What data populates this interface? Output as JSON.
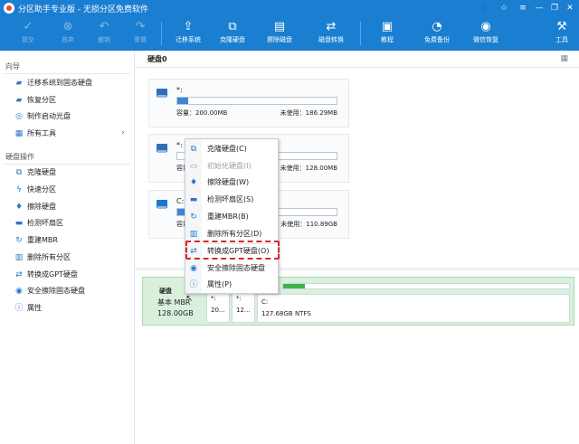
{
  "window": {
    "title": "分区助手专业版 - 无损分区免费软件"
  },
  "toolbar": {
    "buttons": [
      {
        "label": "提交",
        "icon": "commit-icon",
        "enabled": false
      },
      {
        "label": "放弃",
        "icon": "discard-icon",
        "enabled": false
      },
      {
        "label": "撤销",
        "icon": "undo-icon",
        "enabled": false
      },
      {
        "label": "重做",
        "icon": "redo-icon",
        "enabled": false
      },
      {
        "label": "迁移系统",
        "icon": "migrate-os-icon",
        "enabled": true
      },
      {
        "label": "克隆硬盘",
        "icon": "clone-disk-icon",
        "enabled": true
      },
      {
        "label": "擦除磁盘",
        "icon": "wipe-disk-icon",
        "enabled": true
      },
      {
        "label": "磁盘转换",
        "icon": "convert-disk-icon",
        "enabled": true
      },
      {
        "label": "教程",
        "icon": "tutorial-icon",
        "enabled": true
      },
      {
        "label": "免费备份",
        "icon": "backup-icon",
        "enabled": true
      },
      {
        "label": "微信恢复",
        "icon": "wechat-recovery-icon",
        "enabled": true
      },
      {
        "label": "工具",
        "icon": "tools-icon",
        "enabled": true
      }
    ]
  },
  "sidebar": {
    "wizard_title": "向导",
    "wizard_items": [
      {
        "label": "迁移系统到固态硬盘",
        "icon": "migrate-icon"
      },
      {
        "label": "恢复分区",
        "icon": "restore-icon"
      },
      {
        "label": "制作启动光盘",
        "icon": "bootdisk-icon"
      },
      {
        "label": "所有工具",
        "icon": "all-tools-icon",
        "arrow": "›"
      }
    ],
    "disk_ops_title": "硬盘操作",
    "disk_ops_items": [
      {
        "label": "克隆硬盘",
        "icon": "clone-icon"
      },
      {
        "label": "快速分区",
        "icon": "quick-partition-icon"
      },
      {
        "label": "擦除硬盘",
        "icon": "wipe-icon"
      },
      {
        "label": "检测坏扇区",
        "icon": "bad-sector-icon"
      },
      {
        "label": "重建MBR",
        "icon": "mbr-icon"
      },
      {
        "label": "删除所有分区",
        "icon": "delete-all-icon"
      },
      {
        "label": "转换成GPT硬盘",
        "icon": "gpt-icon"
      },
      {
        "label": "安全擦除固态硬盘",
        "icon": "secure-erase-icon"
      },
      {
        "label": "属性",
        "icon": "info-icon"
      }
    ]
  },
  "main": {
    "header_title": "硬盘0",
    "partitions": [
      {
        "name": "*:",
        "capacity": "容量：200.00MB",
        "free": "未使用：186.29MB",
        "fill": 0.07
      },
      {
        "name": "*:",
        "capacity": "容量：",
        "free": "未使用：128.00MB",
        "fill": 0.0
      },
      {
        "name": "C:",
        "capacity": "容量：",
        "free": "未使用：110.89GB",
        "fill": 0.13
      }
    ]
  },
  "bottom_disk": {
    "name": "硬盘",
    "type": "基本 MBR",
    "size": "128.00GB",
    "parts": [
      {
        "name": "*:",
        "info": "20..."
      },
      {
        "name": "*:",
        "info": "12..."
      },
      {
        "name": "C:",
        "info": "127.68GB NTFS"
      }
    ]
  },
  "context_menu": {
    "items": [
      {
        "label": "克隆硬盘(C)",
        "icon": "clone-disk-icon",
        "enabled": true
      },
      {
        "label": "初始化硬盘(I)",
        "icon": "init-disk-icon",
        "enabled": false
      },
      {
        "label": "擦除硬盘(W)",
        "icon": "wipe-disk-icon",
        "enabled": true
      },
      {
        "label": "检测坏扇区(S)",
        "icon": "bad-sector-icon",
        "enabled": true
      },
      {
        "label": "重建MBR(B)",
        "icon": "mbr-icon",
        "enabled": true
      },
      {
        "label": "删除所有分区(D)",
        "icon": "delete-all-icon",
        "enabled": true
      },
      {
        "label": "转换成GPT硬盘(O)",
        "icon": "gpt-icon",
        "enabled": true,
        "highlighted": true
      },
      {
        "label": "安全擦除固态硬盘",
        "icon": "secure-erase-icon",
        "enabled": true
      },
      {
        "label": "属性(P)",
        "icon": "info-icon",
        "enabled": true
      }
    ]
  },
  "colors": {
    "accent": "#1a7fd1",
    "highlight": "#d42a2a",
    "partition_bar": "#3cb34a"
  }
}
